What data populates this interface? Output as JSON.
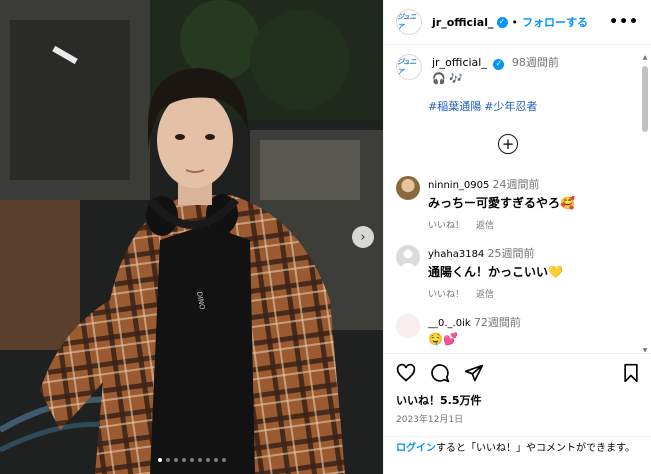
{
  "post": {
    "account": "jr_official_",
    "account_logo_text": "ジュニア",
    "separator": "•",
    "follow_label": "フォローする",
    "more_label": "•••",
    "caption": {
      "time": "98週間前",
      "emojis": "🎧 🎶",
      "hashtags": [
        "#稲葉通陽",
        "#少年忍者"
      ]
    },
    "load_more_label": "+",
    "likes": "いいね！5.5万件",
    "date": "2023年12月1日"
  },
  "comments": [
    {
      "user": "ninnin_0905",
      "time": "24週間前",
      "text": "みっちー可愛すぎるやろ🥰",
      "like": "いいね！",
      "reply": "返信"
    },
    {
      "user": "yhaha3184",
      "time": "25週間前",
      "text": "通陽くん！かっこいい💛",
      "like": "いいね！",
      "reply": "返信"
    },
    {
      "user": "__0._.0ik",
      "time": "72週間前",
      "text": "🤤💕",
      "like": "",
      "reply": ""
    }
  ],
  "login_prompt": {
    "link": "ログイン",
    "rest": "すると「いいね！」やコメントができます。"
  },
  "carousel": {
    "next_label": "›",
    "slide_count": 9,
    "active_index": 0
  },
  "colors": {
    "accent": "#0095f6",
    "hashtag": "#2060c0",
    "muted": "#737373"
  }
}
